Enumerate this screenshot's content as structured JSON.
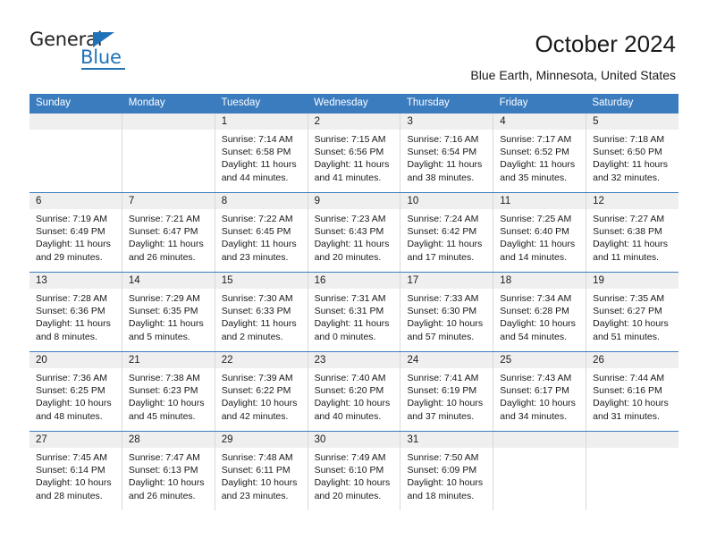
{
  "brand": {
    "name_part1": "General",
    "name_part2": "Blue",
    "triangle_icon": "triangle-icon",
    "accent_color": "#1f72b8"
  },
  "header": {
    "title": "October 2024",
    "subtitle": "Blue Earth, Minnesota, United States"
  },
  "theme": {
    "header_blue": "#3b7cbf",
    "date_band_gray": "#efefef",
    "cell_border": "#d9d9d9",
    "text": "#1a1a1a"
  },
  "weekdays": [
    "Sunday",
    "Monday",
    "Tuesday",
    "Wednesday",
    "Thursday",
    "Friday",
    "Saturday"
  ],
  "weeks": [
    [
      {
        "day": "",
        "empty": true,
        "sunrise": "",
        "sunset": "",
        "daylight_line1": "",
        "daylight_line2": ""
      },
      {
        "day": "",
        "empty": true,
        "sunrise": "",
        "sunset": "",
        "daylight_line1": "",
        "daylight_line2": ""
      },
      {
        "day": "1",
        "sunrise": "Sunrise: 7:14 AM",
        "sunset": "Sunset: 6:58 PM",
        "daylight_line1": "Daylight: 11 hours",
        "daylight_line2": "and 44 minutes."
      },
      {
        "day": "2",
        "sunrise": "Sunrise: 7:15 AM",
        "sunset": "Sunset: 6:56 PM",
        "daylight_line1": "Daylight: 11 hours",
        "daylight_line2": "and 41 minutes."
      },
      {
        "day": "3",
        "sunrise": "Sunrise: 7:16 AM",
        "sunset": "Sunset: 6:54 PM",
        "daylight_line1": "Daylight: 11 hours",
        "daylight_line2": "and 38 minutes."
      },
      {
        "day": "4",
        "sunrise": "Sunrise: 7:17 AM",
        "sunset": "Sunset: 6:52 PM",
        "daylight_line1": "Daylight: 11 hours",
        "daylight_line2": "and 35 minutes."
      },
      {
        "day": "5",
        "sunrise": "Sunrise: 7:18 AM",
        "sunset": "Sunset: 6:50 PM",
        "daylight_line1": "Daylight: 11 hours",
        "daylight_line2": "and 32 minutes."
      }
    ],
    [
      {
        "day": "6",
        "sunrise": "Sunrise: 7:19 AM",
        "sunset": "Sunset: 6:49 PM",
        "daylight_line1": "Daylight: 11 hours",
        "daylight_line2": "and 29 minutes."
      },
      {
        "day": "7",
        "sunrise": "Sunrise: 7:21 AM",
        "sunset": "Sunset: 6:47 PM",
        "daylight_line1": "Daylight: 11 hours",
        "daylight_line2": "and 26 minutes."
      },
      {
        "day": "8",
        "sunrise": "Sunrise: 7:22 AM",
        "sunset": "Sunset: 6:45 PM",
        "daylight_line1": "Daylight: 11 hours",
        "daylight_line2": "and 23 minutes."
      },
      {
        "day": "9",
        "sunrise": "Sunrise: 7:23 AM",
        "sunset": "Sunset: 6:43 PM",
        "daylight_line1": "Daylight: 11 hours",
        "daylight_line2": "and 20 minutes."
      },
      {
        "day": "10",
        "sunrise": "Sunrise: 7:24 AM",
        "sunset": "Sunset: 6:42 PM",
        "daylight_line1": "Daylight: 11 hours",
        "daylight_line2": "and 17 minutes."
      },
      {
        "day": "11",
        "sunrise": "Sunrise: 7:25 AM",
        "sunset": "Sunset: 6:40 PM",
        "daylight_line1": "Daylight: 11 hours",
        "daylight_line2": "and 14 minutes."
      },
      {
        "day": "12",
        "sunrise": "Sunrise: 7:27 AM",
        "sunset": "Sunset: 6:38 PM",
        "daylight_line1": "Daylight: 11 hours",
        "daylight_line2": "and 11 minutes."
      }
    ],
    [
      {
        "day": "13",
        "sunrise": "Sunrise: 7:28 AM",
        "sunset": "Sunset: 6:36 PM",
        "daylight_line1": "Daylight: 11 hours",
        "daylight_line2": "and 8 minutes."
      },
      {
        "day": "14",
        "sunrise": "Sunrise: 7:29 AM",
        "sunset": "Sunset: 6:35 PM",
        "daylight_line1": "Daylight: 11 hours",
        "daylight_line2": "and 5 minutes."
      },
      {
        "day": "15",
        "sunrise": "Sunrise: 7:30 AM",
        "sunset": "Sunset: 6:33 PM",
        "daylight_line1": "Daylight: 11 hours",
        "daylight_line2": "and 2 minutes."
      },
      {
        "day": "16",
        "sunrise": "Sunrise: 7:31 AM",
        "sunset": "Sunset: 6:31 PM",
        "daylight_line1": "Daylight: 11 hours",
        "daylight_line2": "and 0 minutes."
      },
      {
        "day": "17",
        "sunrise": "Sunrise: 7:33 AM",
        "sunset": "Sunset: 6:30 PM",
        "daylight_line1": "Daylight: 10 hours",
        "daylight_line2": "and 57 minutes."
      },
      {
        "day": "18",
        "sunrise": "Sunrise: 7:34 AM",
        "sunset": "Sunset: 6:28 PM",
        "daylight_line1": "Daylight: 10 hours",
        "daylight_line2": "and 54 minutes."
      },
      {
        "day": "19",
        "sunrise": "Sunrise: 7:35 AM",
        "sunset": "Sunset: 6:27 PM",
        "daylight_line1": "Daylight: 10 hours",
        "daylight_line2": "and 51 minutes."
      }
    ],
    [
      {
        "day": "20",
        "sunrise": "Sunrise: 7:36 AM",
        "sunset": "Sunset: 6:25 PM",
        "daylight_line1": "Daylight: 10 hours",
        "daylight_line2": "and 48 minutes."
      },
      {
        "day": "21",
        "sunrise": "Sunrise: 7:38 AM",
        "sunset": "Sunset: 6:23 PM",
        "daylight_line1": "Daylight: 10 hours",
        "daylight_line2": "and 45 minutes."
      },
      {
        "day": "22",
        "sunrise": "Sunrise: 7:39 AM",
        "sunset": "Sunset: 6:22 PM",
        "daylight_line1": "Daylight: 10 hours",
        "daylight_line2": "and 42 minutes."
      },
      {
        "day": "23",
        "sunrise": "Sunrise: 7:40 AM",
        "sunset": "Sunset: 6:20 PM",
        "daylight_line1": "Daylight: 10 hours",
        "daylight_line2": "and 40 minutes."
      },
      {
        "day": "24",
        "sunrise": "Sunrise: 7:41 AM",
        "sunset": "Sunset: 6:19 PM",
        "daylight_line1": "Daylight: 10 hours",
        "daylight_line2": "and 37 minutes."
      },
      {
        "day": "25",
        "sunrise": "Sunrise: 7:43 AM",
        "sunset": "Sunset: 6:17 PM",
        "daylight_line1": "Daylight: 10 hours",
        "daylight_line2": "and 34 minutes."
      },
      {
        "day": "26",
        "sunrise": "Sunrise: 7:44 AM",
        "sunset": "Sunset: 6:16 PM",
        "daylight_line1": "Daylight: 10 hours",
        "daylight_line2": "and 31 minutes."
      }
    ],
    [
      {
        "day": "27",
        "sunrise": "Sunrise: 7:45 AM",
        "sunset": "Sunset: 6:14 PM",
        "daylight_line1": "Daylight: 10 hours",
        "daylight_line2": "and 28 minutes."
      },
      {
        "day": "28",
        "sunrise": "Sunrise: 7:47 AM",
        "sunset": "Sunset: 6:13 PM",
        "daylight_line1": "Daylight: 10 hours",
        "daylight_line2": "and 26 minutes."
      },
      {
        "day": "29",
        "sunrise": "Sunrise: 7:48 AM",
        "sunset": "Sunset: 6:11 PM",
        "daylight_line1": "Daylight: 10 hours",
        "daylight_line2": "and 23 minutes."
      },
      {
        "day": "30",
        "sunrise": "Sunrise: 7:49 AM",
        "sunset": "Sunset: 6:10 PM",
        "daylight_line1": "Daylight: 10 hours",
        "daylight_line2": "and 20 minutes."
      },
      {
        "day": "31",
        "sunrise": "Sunrise: 7:50 AM",
        "sunset": "Sunset: 6:09 PM",
        "daylight_line1": "Daylight: 10 hours",
        "daylight_line2": "and 18 minutes."
      },
      {
        "day": "",
        "empty": true,
        "sunrise": "",
        "sunset": "",
        "daylight_line1": "",
        "daylight_line2": ""
      },
      {
        "day": "",
        "empty": true,
        "sunrise": "",
        "sunset": "",
        "daylight_line1": "",
        "daylight_line2": ""
      }
    ]
  ]
}
